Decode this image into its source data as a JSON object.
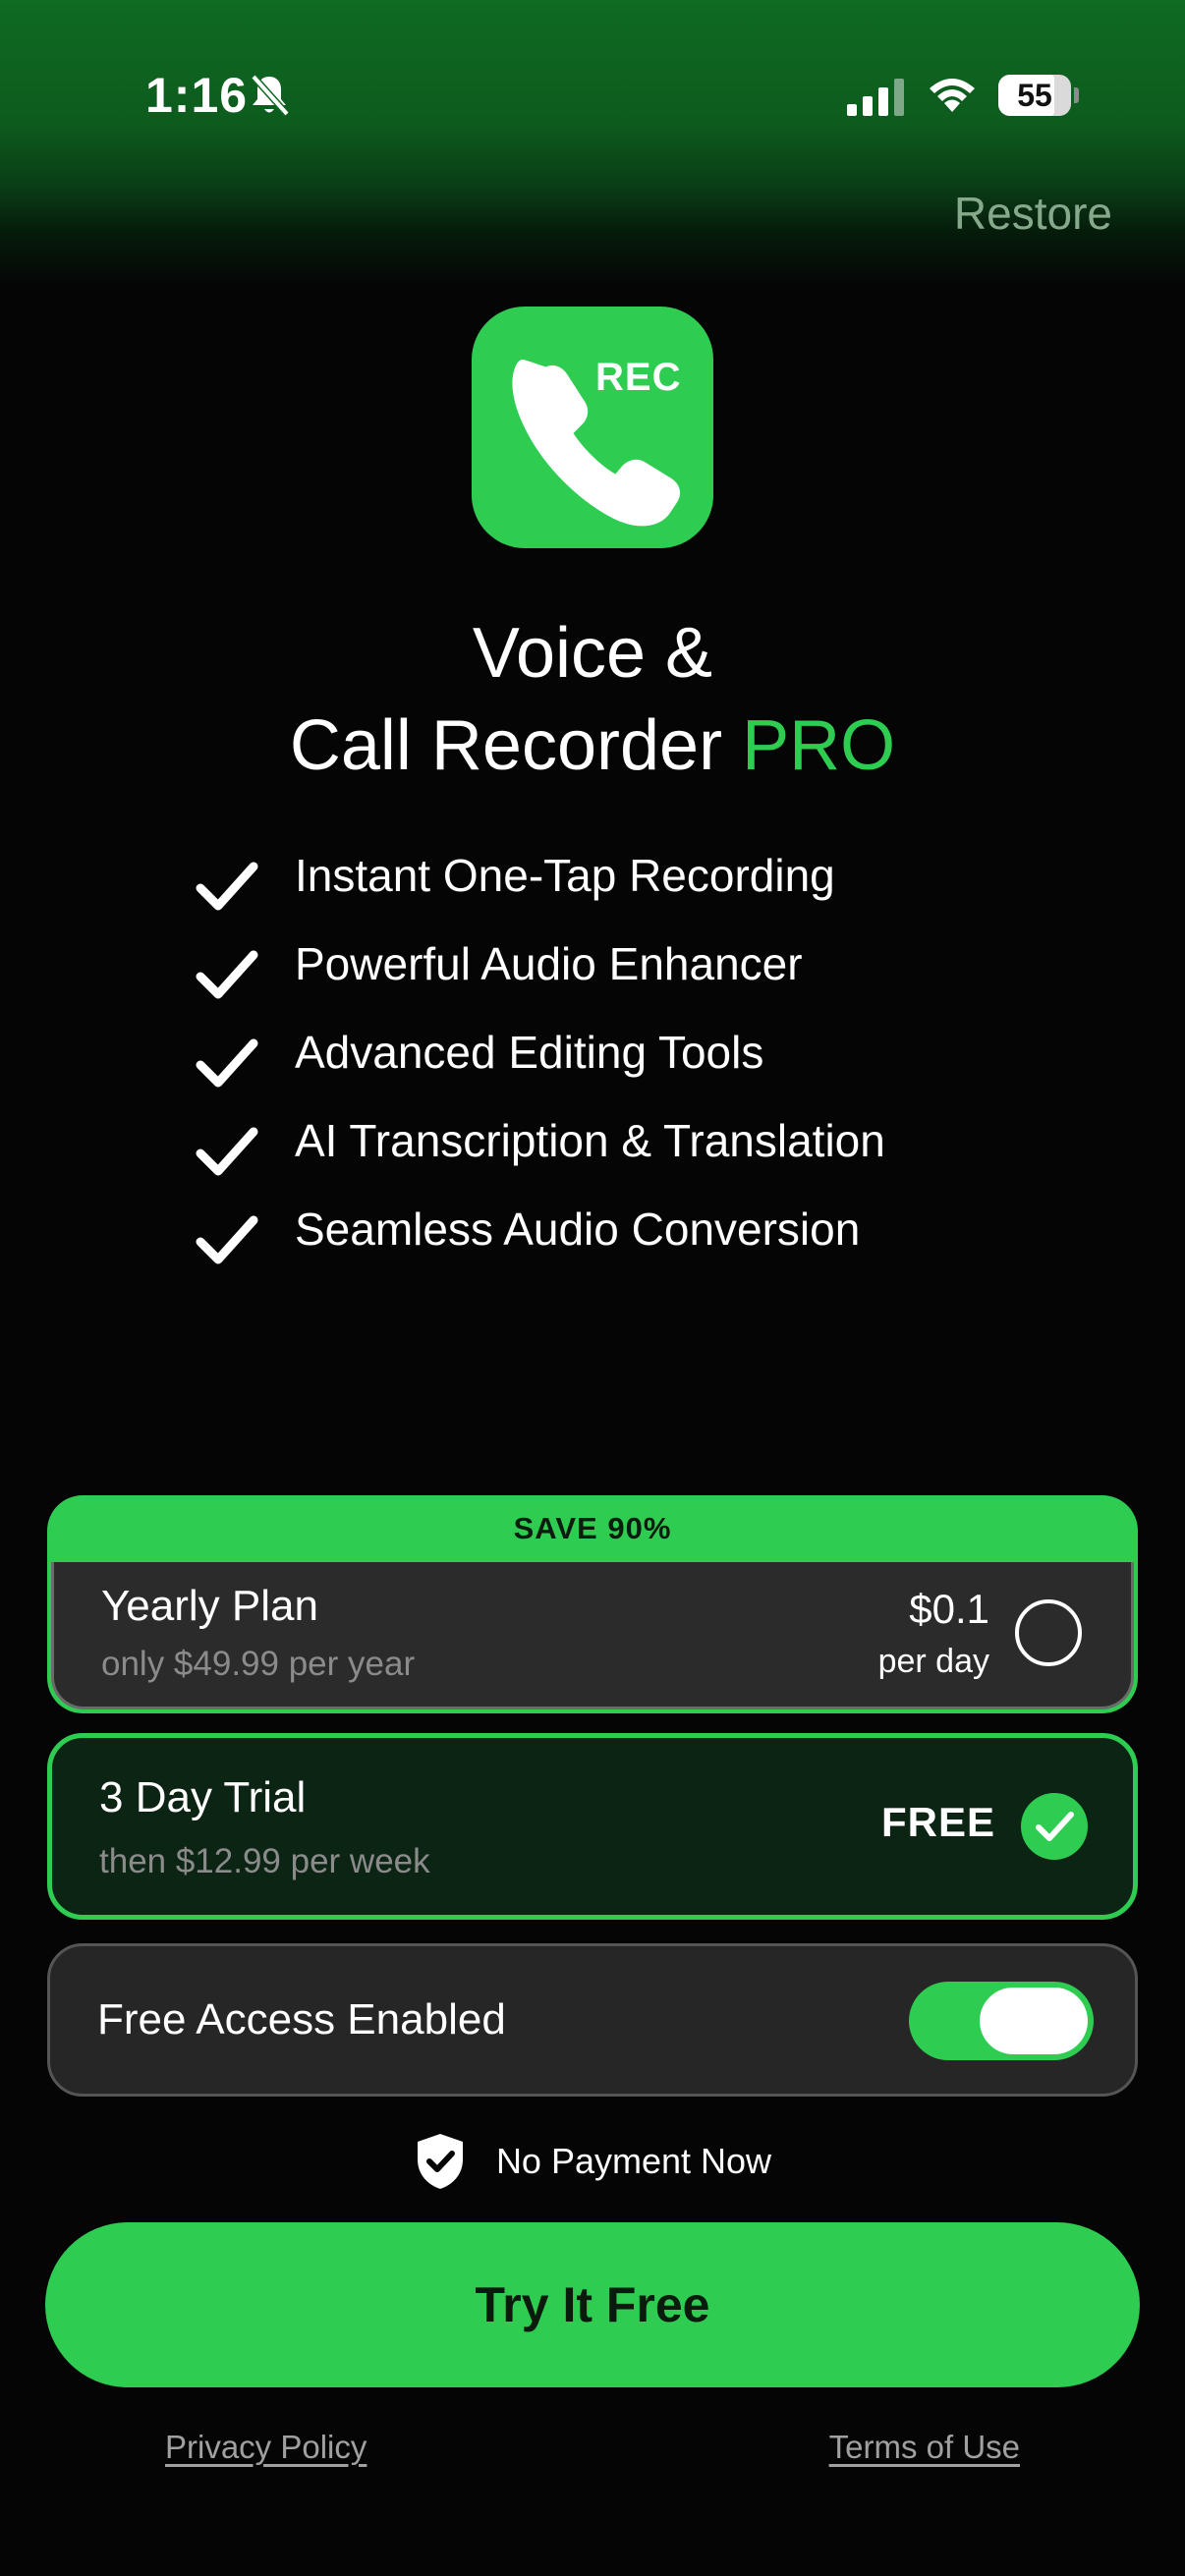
{
  "status_bar": {
    "time": "1:16",
    "battery": "55",
    "icons": [
      "bell-off-icon",
      "cellular-signal-icon",
      "wifi-icon",
      "battery-icon"
    ]
  },
  "header": {
    "restore_label": "Restore"
  },
  "app_icon": {
    "badge_text": "REC",
    "icon": "phone-icon"
  },
  "title": {
    "line1": "Voice &",
    "line2_main": "Call Recorder ",
    "line2_accent": "PRO"
  },
  "features": [
    "Instant One-Tap Recording",
    "Powerful Audio Enhancer",
    "Advanced Editing Tools",
    "AI Transcription & Translation",
    "Seamless Audio Conversion"
  ],
  "plans": {
    "yearly": {
      "banner": "SAVE  90%",
      "name": "Yearly Plan",
      "subtitle": "only $49.99 per year",
      "price": "$0.1",
      "price_unit": "per day",
      "selected": false
    },
    "trial": {
      "name": "3 Day Trial",
      "subtitle": "then $12.99 per week",
      "price": "FREE",
      "selected": true
    }
  },
  "free_access": {
    "label": "Free Access Enabled",
    "enabled": true
  },
  "no_payment": {
    "text": "No Payment Now",
    "icon": "shield-check-icon"
  },
  "cta": {
    "label": "Try It Free"
  },
  "footer": {
    "privacy": "Privacy Policy",
    "terms": "Terms of Use"
  },
  "colors": {
    "accent": "#2ecd52",
    "background": "#050505",
    "card": "#2b2b2b"
  }
}
